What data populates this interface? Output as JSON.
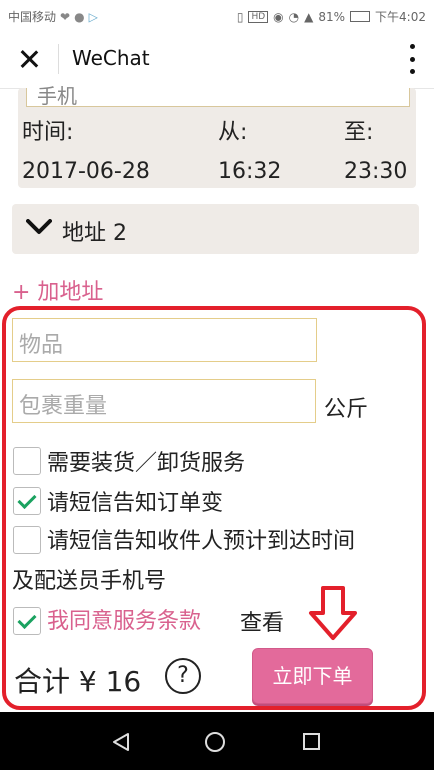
{
  "status_bar": {
    "carrier": "中国移动",
    "battery": "81%",
    "time": "下午4:02",
    "icons": [
      "heart-icon",
      "chat-bubble-icon",
      "vibrate-icon",
      "hd-icon",
      "eye-icon",
      "wifi-icon",
      "signal-icon",
      "battery-icon"
    ]
  },
  "header": {
    "title": "WeChat"
  },
  "time_block": {
    "partial_text": "手机",
    "date_label": "时间:",
    "date_value": "2017-06-28",
    "from_label": "从:",
    "from_value": "16:32",
    "to_label": "至:",
    "to_value": "23:30"
  },
  "address2": {
    "label": "地址 2"
  },
  "add_address": {
    "label": "+ 加地址"
  },
  "form": {
    "item_placeholder": "物品",
    "weight_placeholder": "包裹重量",
    "weight_unit": "公斤",
    "options": [
      {
        "label": "需要装货／卸货服务",
        "checked": false
      },
      {
        "label": "请短信告知订单变",
        "checked": true
      },
      {
        "label": "请短信告知收件人预计到达时间",
        "label_line2": "及配送员手机号",
        "checked": false
      }
    ],
    "agree_label": "我同意服务条款",
    "agree_checked": true,
    "view_link": "查看"
  },
  "footer": {
    "total_text": "合计 ¥ 16",
    "help_label": "?",
    "order_button": "立即下单"
  },
  "colors": {
    "accent_pink": "#e36a9b",
    "annotation_red": "#e3202b",
    "check_green": "#1aa260",
    "card_bg": "#efebe7"
  }
}
